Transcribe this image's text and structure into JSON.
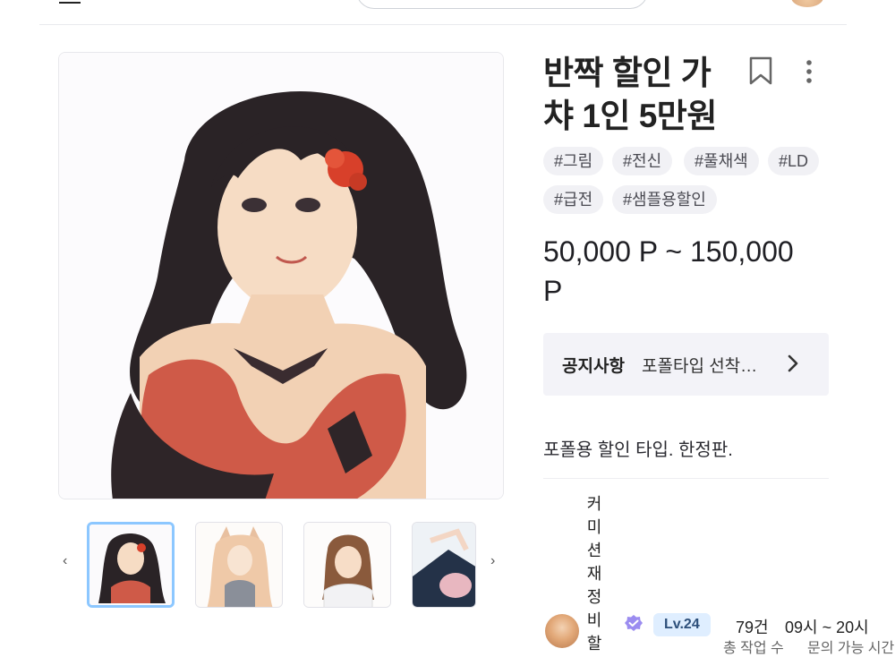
{
  "header": {
    "menu_icon": "hamburger-icon"
  },
  "product": {
    "title_line1": "반짝 할인 가",
    "title_line2": "챠 1인 5만원",
    "tags": [
      "#그림",
      "#전신",
      "#풀채색",
      "#LD",
      "#급전",
      "#샘플용할인"
    ],
    "price_line1": "50,000 P ~ 150,000",
    "price_line2": "P",
    "notice": {
      "label": "공지사항",
      "text": "포폴타입 선착…"
    },
    "description": "포폴용 할인 타입. 한정판."
  },
  "seller": {
    "vertical_label": "커미션재정비할",
    "level": "Lv.24",
    "count": "79건",
    "hours": "09시 ~ 20시",
    "sub_left": "총 작업 수",
    "sub_right": "문의 가능 시간"
  },
  "gallery": {
    "thumb_count": 4,
    "active_index": 0
  },
  "colors": {
    "accent_thumb_border": "#8cc7ff",
    "verified": "#9b8cf0",
    "level_bg": "#dfeeff"
  },
  "icons": [
    "hamburger-icon",
    "bookmark-icon",
    "more-vertical-icon",
    "chevron-right-icon",
    "chevron-left-icon",
    "verified-badge-icon"
  ]
}
